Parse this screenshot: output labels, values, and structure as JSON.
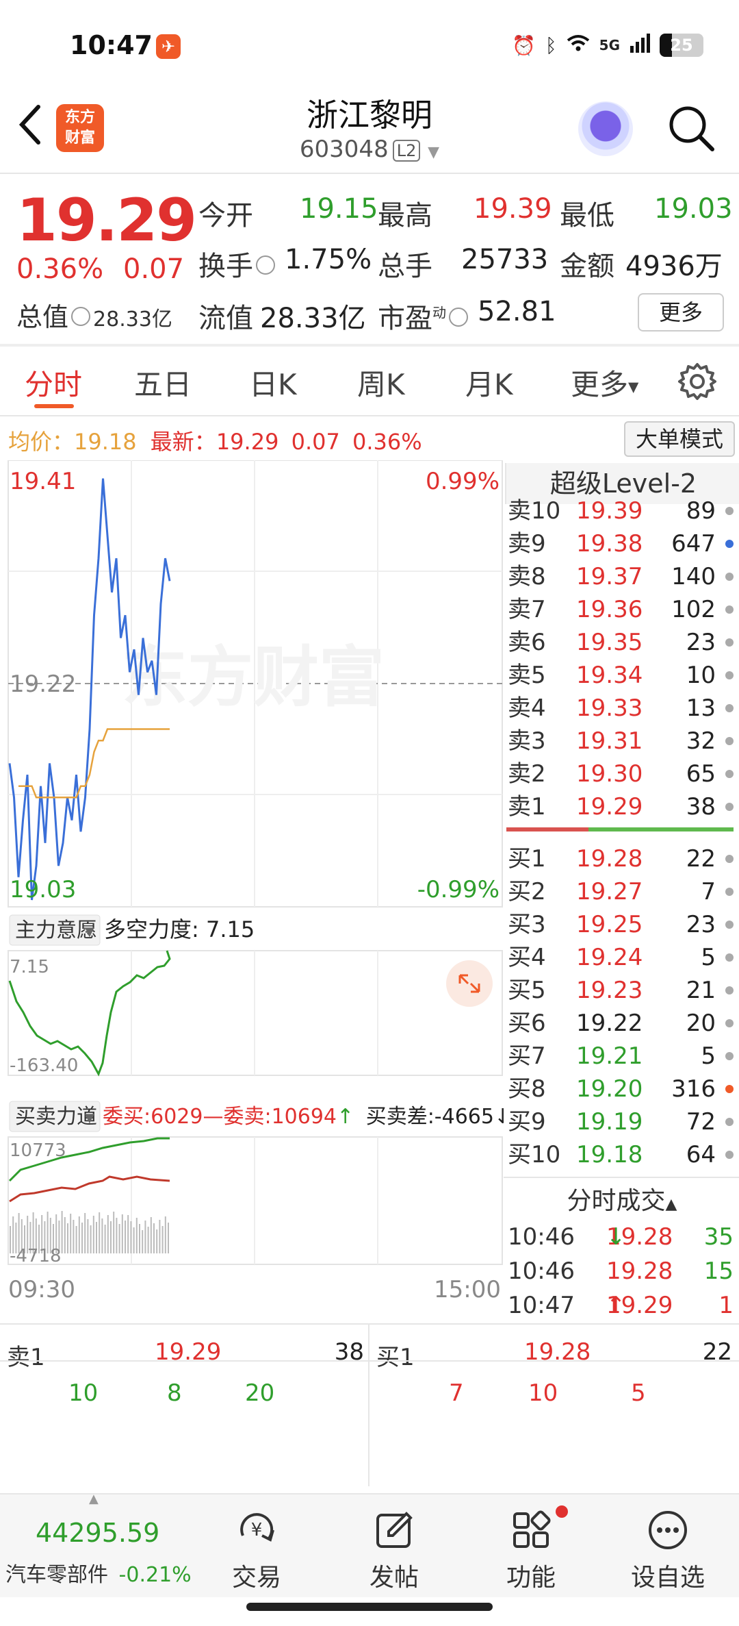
{
  "status": {
    "time": "10:47",
    "network": "5G",
    "battery": "25"
  },
  "header": {
    "name": "浙江黎明",
    "code": "603048",
    "level_tag": "L2",
    "logo_text_1": "东方",
    "logo_text_2": "财富"
  },
  "quote": {
    "price": "19.29",
    "change_pct": "0.36%",
    "change": "0.07",
    "open_label": "今开",
    "open": "19.15",
    "high_label": "最高",
    "high": "19.39",
    "low_label": "最低",
    "low": "19.03",
    "turnover_label": "换手",
    "turnover": "1.75%",
    "volume_label": "总手",
    "volume": "25733",
    "amount_label": "金额",
    "amount": "4936万",
    "mkt_cap_label": "总值",
    "mkt_cap": "28.33亿",
    "float_cap_label": "流值",
    "float_cap": "28.33亿",
    "pe_label": "市盈",
    "pe_sup": "动",
    "pe": "52.81",
    "more_label": "更多"
  },
  "tabs": {
    "t1": "分时",
    "t2": "五日",
    "t3": "日K",
    "t4": "周K",
    "t5": "月K",
    "t6": "更多"
  },
  "info_row": {
    "avg_label": "均价：",
    "avg": "19.18",
    "latest_label": "最新：",
    "latest": "19.29",
    "latest_chg": "0.07",
    "latest_pct": "0.36%",
    "big_order_btn": "大单模式"
  },
  "chart": {
    "y_top": "19.41",
    "y_mid": "19.22",
    "y_bottom": "19.03",
    "pct_top": "0.99%",
    "pct_bottom": "-0.99%",
    "watermark": "东方财富",
    "ind1_name": "主力意愿",
    "ind1_value": "多空力度: 7.15",
    "ind1_max": "7.15",
    "ind1_min": "-163.40",
    "ind2_name": "买卖力道",
    "ind2_buy": "委买:6029",
    "ind2_sep": "—",
    "ind2_sell": "委卖:10694",
    "ind2_sell_arrow": "↑",
    "ind2_diff": "买卖差:-4665",
    "ind2_diff_arrow": "↓",
    "ind2_max": "10773",
    "ind2_min": "-4718",
    "x_start": "09:30",
    "x_end": "15:00",
    "chart_data": {
      "type": "line",
      "price_series": [
        19.15,
        19.12,
        19.05,
        19.1,
        19.14,
        19.03,
        19.06,
        19.13,
        19.08,
        19.15,
        19.12,
        19.06,
        19.08,
        19.12,
        19.1,
        19.14,
        19.09,
        19.12,
        19.18,
        19.28,
        19.33,
        19.4,
        19.35,
        19.3,
        19.33,
        19.26,
        19.28,
        19.23,
        19.25,
        19.21,
        19.26,
        19.23,
        19.24,
        19.21,
        19.29,
        19.33,
        19.31
      ],
      "avg_series": [
        19.15,
        19.14,
        19.13,
        19.13,
        19.13,
        19.13,
        19.12,
        19.12,
        19.12,
        19.12,
        19.12,
        19.12,
        19.12,
        19.12,
        19.12,
        19.12,
        19.13,
        19.13,
        19.14,
        19.16,
        19.17,
        19.17,
        19.18,
        19.18,
        19.18,
        19.18,
        19.18,
        19.18,
        19.18,
        19.18,
        19.18,
        19.18,
        19.18,
        19.18,
        19.18,
        19.18,
        19.18
      ],
      "y_range": [
        19.03,
        19.41
      ]
    }
  },
  "level2": {
    "title": "超级Level-2",
    "asks": [
      {
        "label": "卖10",
        "price": "19.39",
        "qty": "89",
        "dot": "#aaaaaa"
      },
      {
        "label": "卖9",
        "price": "19.38",
        "qty": "647",
        "dot": "#3a6fd8"
      },
      {
        "label": "卖8",
        "price": "19.37",
        "qty": "140",
        "dot": "#aaaaaa"
      },
      {
        "label": "卖7",
        "price": "19.36",
        "qty": "102",
        "dot": "#aaaaaa"
      },
      {
        "label": "卖6",
        "price": "19.35",
        "qty": "23",
        "dot": "#aaaaaa"
      },
      {
        "label": "卖5",
        "price": "19.34",
        "qty": "10",
        "dot": "#aaaaaa"
      },
      {
        "label": "卖4",
        "price": "19.33",
        "qty": "13",
        "dot": "#aaaaaa"
      },
      {
        "label": "卖3",
        "price": "19.31",
        "qty": "32",
        "dot": "#aaaaaa"
      },
      {
        "label": "卖2",
        "price": "19.30",
        "qty": "65",
        "dot": "#aaaaaa"
      },
      {
        "label": "卖1",
        "price": "19.29",
        "qty": "38",
        "dot": "#aaaaaa"
      }
    ],
    "bids": [
      {
        "label": "买1",
        "price": "19.28",
        "qty": "22",
        "dot": "#aaaaaa",
        "color": "red"
      },
      {
        "label": "买2",
        "price": "19.27",
        "qty": "7",
        "dot": "#aaaaaa",
        "color": "red"
      },
      {
        "label": "买3",
        "price": "19.25",
        "qty": "23",
        "dot": "#aaaaaa",
        "color": "red"
      },
      {
        "label": "买4",
        "price": "19.24",
        "qty": "5",
        "dot": "#aaaaaa",
        "color": "red"
      },
      {
        "label": "买5",
        "price": "19.23",
        "qty": "21",
        "dot": "#aaaaaa",
        "color": "red"
      },
      {
        "label": "买6",
        "price": "19.22",
        "qty": "20",
        "dot": "#aaaaaa",
        "color": "dark"
      },
      {
        "label": "买7",
        "price": "19.21",
        "qty": "5",
        "dot": "#aaaaaa",
        "color": "green"
      },
      {
        "label": "买8",
        "price": "19.20",
        "qty": "316",
        "dot": "#f05a28",
        "color": "green"
      },
      {
        "label": "买9",
        "price": "19.19",
        "qty": "72",
        "dot": "#aaaaaa",
        "color": "green"
      },
      {
        "label": "买10",
        "price": "19.18",
        "qty": "64",
        "dot": "#aaaaaa",
        "color": "green"
      }
    ],
    "trades_title": "分时成交",
    "trades": [
      {
        "time": "10:46",
        "price": "19.28",
        "arrow": "↓",
        "arrow_color": "green",
        "qty": "35",
        "qty_color": "green"
      },
      {
        "time": "10:46",
        "price": "19.28",
        "arrow": "",
        "arrow_color": "green",
        "qty": "15",
        "qty_color": "green"
      },
      {
        "time": "10:47",
        "price": "19.29",
        "arrow": "↑",
        "arrow_color": "red",
        "qty": "1",
        "qty_color": "red"
      }
    ]
  },
  "bottom_book": {
    "sell_label": "卖1",
    "sell_price": "19.29",
    "sell_qty": "38",
    "sell_orders": [
      "10",
      "8",
      "20"
    ],
    "buy_label": "买1",
    "buy_price": "19.28",
    "buy_qty": "22",
    "buy_orders": [
      "7",
      "10",
      "5"
    ]
  },
  "nav": {
    "index_value": "44295.59",
    "index_name": "汽车零部件",
    "index_chg": "-0.21%",
    "trade": "交易",
    "post": "发帖",
    "func": "功能",
    "watch": "设自选"
  }
}
